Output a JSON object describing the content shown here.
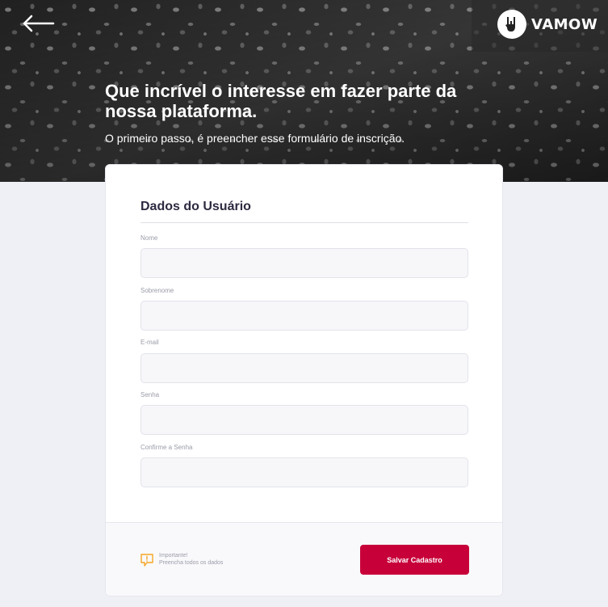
{
  "header": {
    "brand": "VAMOW",
    "headline": "Que incrível o interesse em fazer parte da nossa plataforma.",
    "subhead": "O primeiro passo, é preencher esse formulário de inscrição."
  },
  "form": {
    "title": "Dados do Usuário",
    "fields": [
      {
        "label": "Nome",
        "value": ""
      },
      {
        "label": "Sobrenome",
        "value": ""
      },
      {
        "label": "E-mail",
        "value": ""
      },
      {
        "label": "Senha",
        "value": ""
      },
      {
        "label": "Confirme a Senha",
        "value": ""
      }
    ]
  },
  "footer": {
    "notice_title": "Importante!",
    "notice_text": "Preencha todos os dados",
    "save_label": "Salvar Cadastro"
  },
  "colors": {
    "accent": "#c8003a",
    "notice_icon": "#f5a623",
    "background": "#eff0f6"
  },
  "icons": {
    "back": "arrow-left-icon",
    "logo": "rock-hand-icon",
    "notice": "speech-bubble-alert-icon"
  }
}
